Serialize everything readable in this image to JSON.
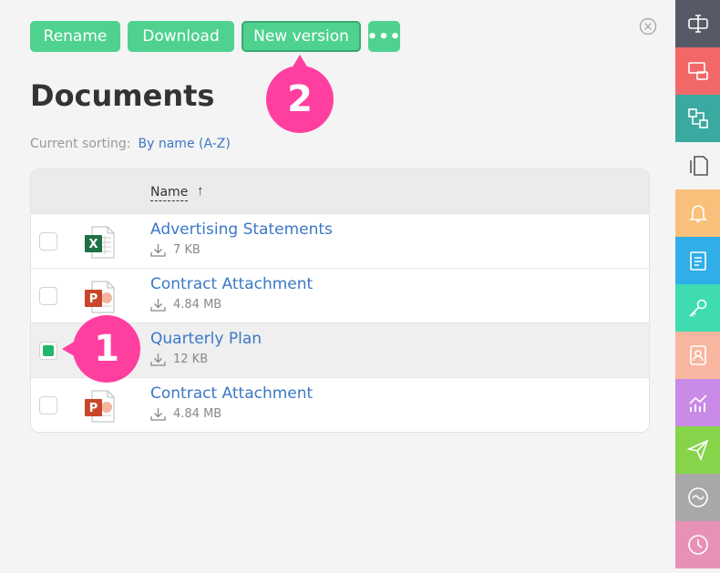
{
  "toolbar": {
    "rename_label": "Rename",
    "download_label": "Download",
    "new_version_label": "New version",
    "more_label": "•••"
  },
  "page": {
    "title": "Documents",
    "sorting_label": "Current sorting:",
    "sorting_value": "By name (A-Z)"
  },
  "table": {
    "name_header": "Name",
    "sort_arrow": "↑",
    "rows": [
      {
        "name": "Advertising Statements",
        "size": "7 KB",
        "type": "excel",
        "selected": false
      },
      {
        "name": "Contract Attachment",
        "size": "4.84 MB",
        "type": "powerpoint",
        "selected": false
      },
      {
        "name": "Quarterly Plan",
        "size": "12 KB",
        "type": "none",
        "selected": true
      },
      {
        "name": "Contract Attachment",
        "size": "4.84 MB",
        "type": "powerpoint",
        "selected": false
      }
    ]
  },
  "badges": {
    "one": "1",
    "two": "2"
  },
  "sidebar": {
    "items": [
      {
        "icon": "text-field-icon",
        "color": "#555a66"
      },
      {
        "icon": "chat-icon",
        "color": "#f26868"
      },
      {
        "icon": "flow-icon",
        "color": "#3aa9a0"
      },
      {
        "icon": "documents-icon",
        "color": "#f4f4f4"
      },
      {
        "icon": "bell-icon",
        "color": "#f8c07a"
      },
      {
        "icon": "clipboard-icon",
        "color": "#30aee8"
      },
      {
        "icon": "key-icon",
        "color": "#3fdcb2"
      },
      {
        "icon": "contact-icon",
        "color": "#f8b6a0"
      },
      {
        "icon": "chart-icon",
        "color": "#c98ae8"
      },
      {
        "icon": "send-icon",
        "color": "#86d44a"
      },
      {
        "icon": "wave-icon",
        "color": "#a8a8a8"
      },
      {
        "icon": "clock-icon",
        "color": "#e891b6"
      }
    ]
  }
}
